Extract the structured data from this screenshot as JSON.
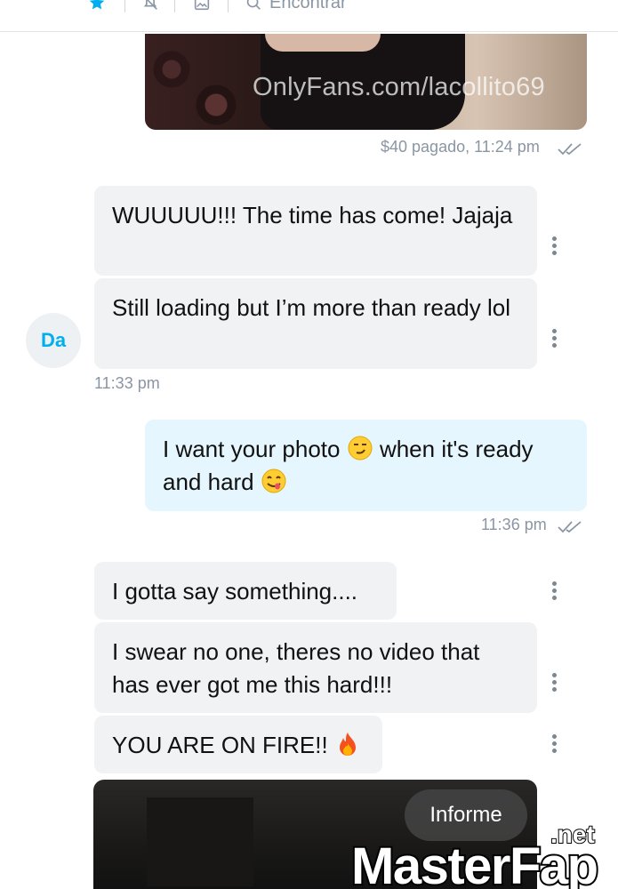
{
  "toolbar": {
    "icons": [
      "star-icon",
      "bell-off-icon",
      "image-icon",
      "search-icon"
    ],
    "search_placeholder": "Encontrar"
  },
  "messages": [
    {
      "type": "photo",
      "direction": "outgoing",
      "watermark": "OnlyFans.com/lacollito69",
      "meta": "$40 pagado, 11:24 pm",
      "read": true
    },
    {
      "type": "text",
      "direction": "incoming",
      "text": "WUUUUU!!! The time has come! Jajaja"
    },
    {
      "type": "text",
      "direction": "incoming",
      "text": "Still loading but I’m more than ready lol"
    },
    {
      "type": "time",
      "direction": "incoming",
      "meta": "11:33 pm"
    },
    {
      "type": "text",
      "direction": "outgoing",
      "text_a": "I want your photo",
      "text_b": "when it's ready and hard",
      "emojis": [
        "smirk-emoji",
        "yum-emoji"
      ],
      "meta": "11:36 pm",
      "read": true
    },
    {
      "type": "text",
      "direction": "incoming",
      "text": "I gotta say something...."
    },
    {
      "type": "text",
      "direction": "incoming",
      "text": "I swear no one, theres no video that has ever got me this hard!!!"
    },
    {
      "type": "text",
      "direction": "incoming",
      "text": "YOU ARE ON FIRE!!",
      "emojis": [
        "fire-emoji"
      ]
    },
    {
      "type": "photo",
      "direction": "incoming",
      "action": "Informe"
    }
  ],
  "sender": {
    "initials": "Da"
  },
  "watermark_brand": {
    "main": "MasterFap",
    "suffix": ".net"
  },
  "colors": {
    "accent": "#00aff0",
    "incoming_bubble": "#f0f2f3",
    "outgoing_bubble": "#e6f6fe",
    "meta_text": "#8a96a3"
  }
}
